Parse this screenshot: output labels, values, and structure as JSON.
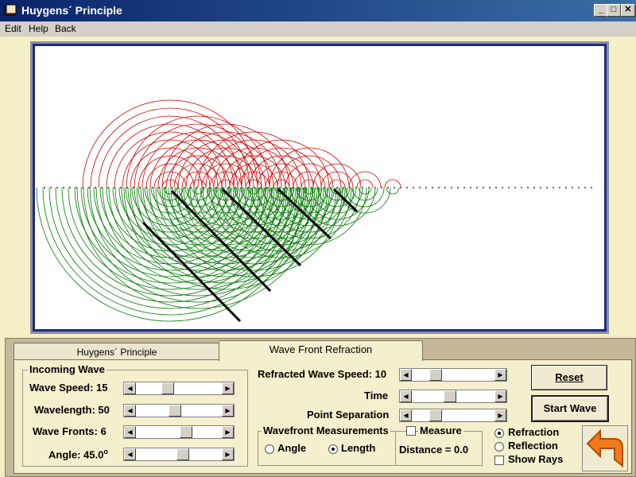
{
  "window": {
    "title": "Huygens´ Principle",
    "minimize": "_",
    "maximize": "□",
    "close": "✕"
  },
  "menu": {
    "edit": "Edit",
    "help": "Help",
    "back": "Back"
  },
  "tabs": [
    {
      "label": "Huygens´ Principle"
    },
    {
      "label": "Wave Front Refraction"
    }
  ],
  "incoming": {
    "group_title": "Incoming Wave",
    "wave_speed_label": "Wave Speed: 15",
    "wavelength_label": "Wavelength: 50",
    "wave_fronts_label": "Wave Fronts: 6",
    "angle_label": "Angle: 45.0",
    "angle_degree_mark": "o",
    "slider_levels": {
      "wave_speed": 0.35,
      "wavelength": 0.45,
      "wave_fronts": 0.6,
      "angle": 0.55
    }
  },
  "refracted": {
    "speed_label": "Refracted Wave Speed: 10",
    "time_label": "Time",
    "point_sep_label": "Point Separation",
    "slider_levels": {
      "speed": 0.25,
      "time": 0.45,
      "point_separation": 0.25
    }
  },
  "measurements": {
    "group_title": "Wavefront Measurements",
    "angle_label": "Angle",
    "length_label": "Length",
    "selected": "Length",
    "measure_label": "Measure",
    "distance_label": "Distance = 0.0"
  },
  "options": {
    "refraction_label": "Refraction",
    "reflection_label": "Reflection",
    "show_rays_label": "Show Rays",
    "selected": "Refraction"
  },
  "buttons": {
    "reset": "Reset",
    "start_wave": "Start Wave"
  },
  "colors": {
    "incoming_wave": "#cc0000",
    "refracted_wave": "#007700",
    "wavefront": "#000000",
    "canvas_border": "#1c2b8a"
  }
}
